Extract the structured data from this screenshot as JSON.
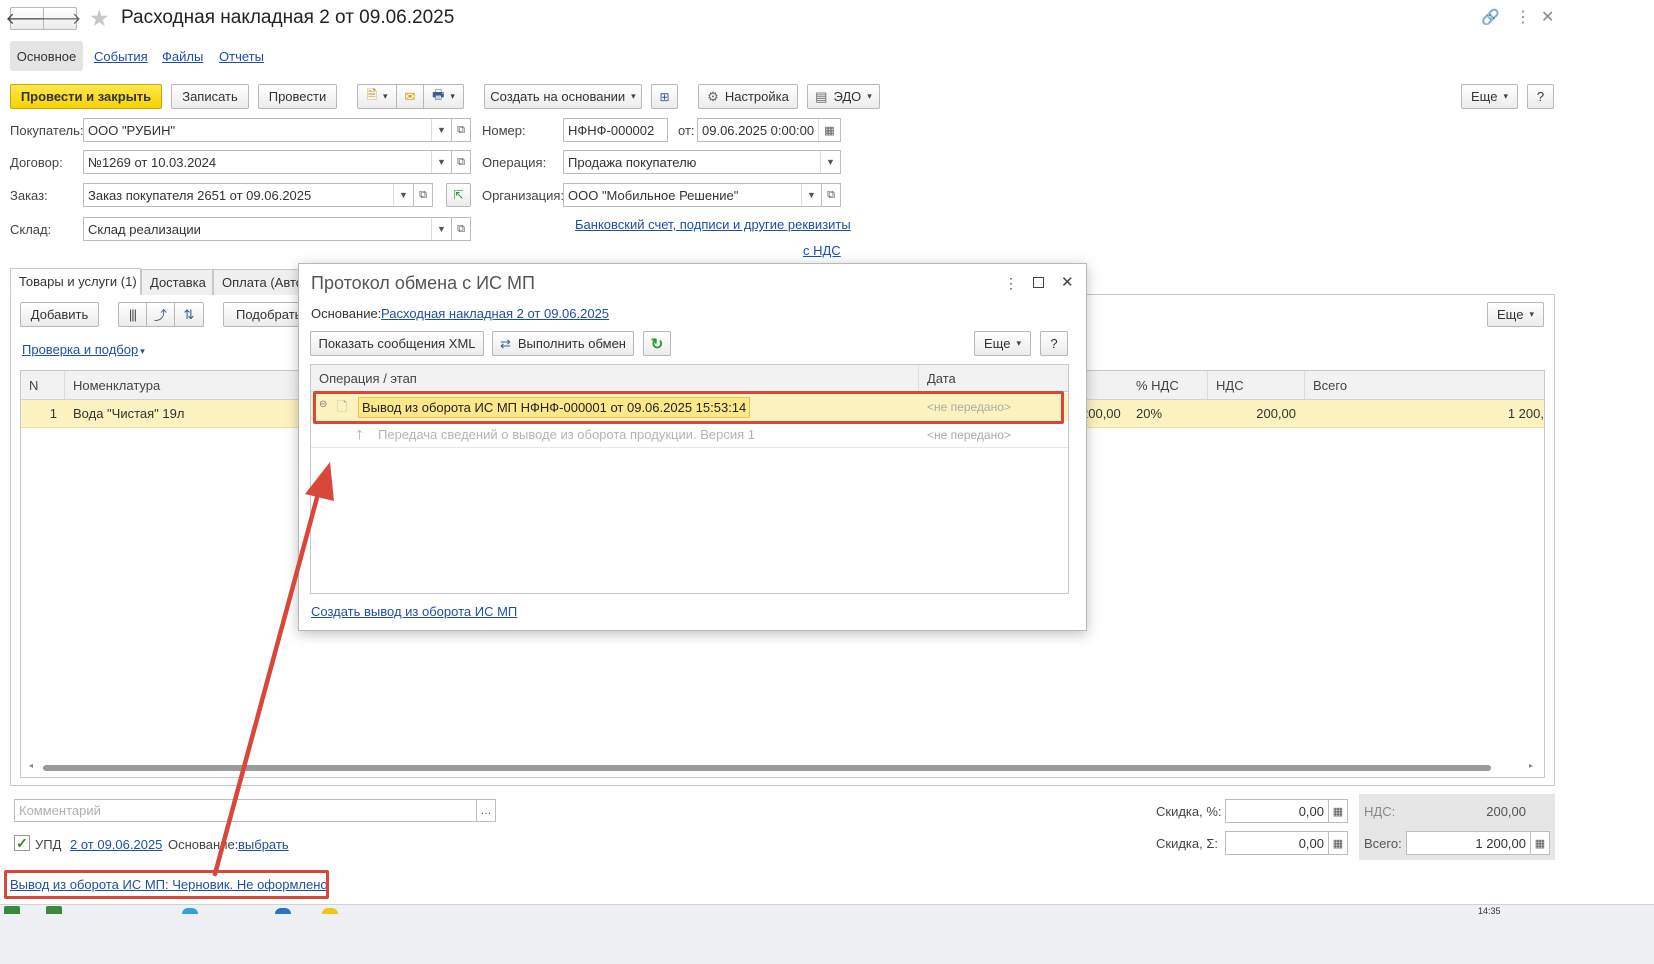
{
  "window": {
    "title": "Расходная накладная 2 от 09.06.2025"
  },
  "nav_tabs": [
    {
      "label": "Основное"
    },
    {
      "label": "События"
    },
    {
      "label": "Файлы"
    },
    {
      "label": "Отчеты"
    }
  ],
  "toolbar": {
    "post_close": "Провести и закрыть",
    "write": "Записать",
    "post": "Провести",
    "create_based": "Создать на основании",
    "settings": "Настройка",
    "edo": "ЭДО",
    "more": "Еще",
    "help": "?"
  },
  "form": {
    "buyer_label": "Покупатель:",
    "buyer_value": "ООО \"РУБИН\"",
    "contract_label": "Договор:",
    "contract_value": "№1269 от 10.03.2024",
    "order_label": "Заказ:",
    "order_value": "Заказ покупателя 2651 от 09.06.2025",
    "warehouse_label": "Склад:",
    "warehouse_value": "Склад реализации",
    "number_label": "Номер:",
    "number_value": "НФНФ-000002",
    "date_label": "от:",
    "date_value": "09.06.2025  0:00:00",
    "operation_label": "Операция:",
    "operation_value": "Продажа покупателю",
    "organization_label": "Организация:",
    "organization_value": "ООО \"Мобильное Решение\"",
    "bank_link": "Банковский счет, подписи и другие реквизиты",
    "vat_link": "с НДС"
  },
  "doc_tabs": [
    {
      "label": "Товары и услуги (1)"
    },
    {
      "label": "Доставка"
    },
    {
      "label": "Оплата (Авто"
    }
  ],
  "table_toolbar": {
    "add": "Добавить",
    "pick": "Подобрать",
    "check_link": "Проверка и подбор",
    "more": "Еще"
  },
  "table": {
    "headers": {
      "n": "N",
      "item": "Номенклатура",
      "vat_rate": "% НДС",
      "vat": "НДС",
      "total": "Всего"
    },
    "rows": [
      {
        "n": "1",
        "item": "Вода \"Чистая\" 19л",
        "price_tail": "200,00",
        "vat_rate": "20%",
        "vat": "200,00",
        "total": "1 200,"
      }
    ]
  },
  "footer": {
    "comment_placeholder": "Комментарий",
    "upd_label": "УПД",
    "upd_link": "2 от 09.06.2025",
    "basis_label": "Основание:",
    "basis_link": "выбрать",
    "discount_pct_label": "Скидка, %:",
    "discount_pct_value": "0,00",
    "discount_sum_label": "Скидка, Σ:",
    "discount_sum_value": "0,00",
    "vat_label": "НДС:",
    "vat_value": "200,00",
    "total_label": "Всего:",
    "total_value": "1 200,00",
    "mp_status_link": "Вывод из оборота ИС МП: Черновик. Не оформлено"
  },
  "dialog": {
    "title": "Протокол обмена с ИС МП",
    "basis_label": "Основание:",
    "basis_link": "Расходная накладная 2 от 09.06.2025",
    "show_xml": "Показать сообщения XML",
    "run_exchange": "Выполнить обмен",
    "more": "Еще",
    "help": "?",
    "col_operation": "Операция / этап",
    "col_date": "Дата",
    "rows": [
      {
        "operation": "Вывод из оборота ИС МП НФНФ-000001 от 09.06.2025 15:53:14",
        "date": "<не передано>"
      },
      {
        "operation": "Передача сведений о выводе из оборота продукции. Версия 1",
        "date": "<не передано>"
      }
    ],
    "create_link": "Создать вывод из оборота ИС МП"
  },
  "taskbar": {
    "clock": "14:35"
  },
  "colors": {
    "accent_yellow": "#f5d300",
    "selected_row": "#fdf3c0",
    "highlight_red": "#d9463a",
    "link_blue": "#1d4fa8"
  }
}
